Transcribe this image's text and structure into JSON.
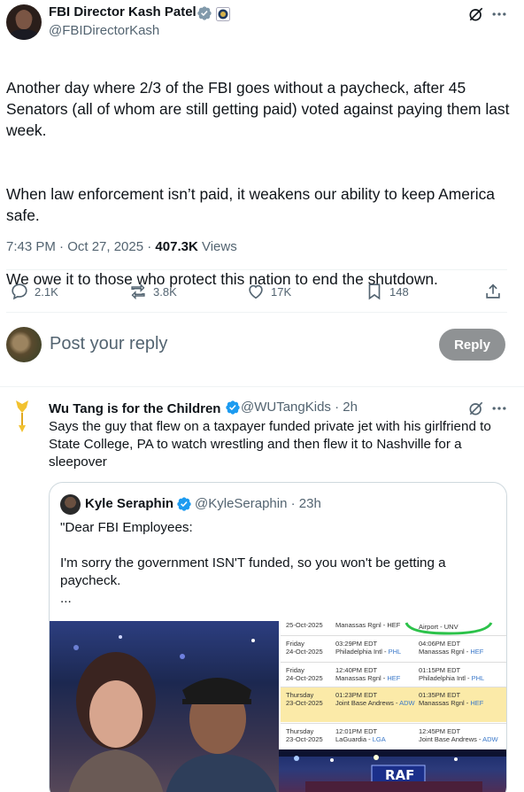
{
  "main_post": {
    "author_name": "FBI Director Kash Patel",
    "handle": "@FBIDirectorKash",
    "paragraphs": [
      "Another day where 2/3 of the FBI goes without a paycheck, after 45 Senators (all of whom are still getting paid) voted against paying them last week.",
      "When law enforcement isn’t paid, it weakens our ability to keep America safe.",
      "We owe it to those who protect this nation to end the shutdown."
    ],
    "timestamp": "7:43 PM · Oct 27, 2025 · ",
    "views_count": "407.3K",
    "views_label": " Views",
    "actions": {
      "replies": "2.1K",
      "reposts": "3.8K",
      "likes": "17K",
      "bookmarks": "148"
    }
  },
  "composer": {
    "placeholder": "Post your reply",
    "button": "Reply"
  },
  "reply": {
    "author_name": "Wu Tang is for the Children",
    "handle_time": "@WUTangKids · 2h",
    "text": "Says the guy that flew on a taxpayer funded private jet with his girlfriend to State College, PA to watch wrestling and then flew it to Nashville for a sleepover"
  },
  "quote": {
    "author_name": "Kyle Seraphin",
    "handle_time": "@KyleSeraphin · 23h",
    "text": "\"Dear FBI Employees:\n\nI'm sorry the government ISN'T funded, so you won't be getting a paycheck.\n..."
  },
  "flight_table": {
    "top_partial": {
      "left": "25-Oct-2025",
      "mid": "Manassas Rgnl - HEF",
      "right": "Airport - UNV"
    },
    "rows": [
      {
        "day": "Friday",
        "date": "24-Oct-2025",
        "dep_time": "03:29PM EDT",
        "dep_place": "Philadelphia Intl - ",
        "dep_code": "PHL",
        "arr_time": "04:06PM EDT",
        "arr_place": "Manassas Rgnl - ",
        "arr_code": "HEF",
        "highlight": false
      },
      {
        "day": "Friday",
        "date": "24-Oct-2025",
        "dep_time": "12:40PM EDT",
        "dep_place": "Manassas Rgnl - ",
        "dep_code": "HEF",
        "arr_time": "01:15PM EDT",
        "arr_place": "Philadelphia Intl - ",
        "arr_code": "PHL",
        "highlight": false
      },
      {
        "day": "Thursday",
        "date": "23-Oct-2025",
        "dep_time": "01:23PM EDT",
        "dep_place": "Joint Base Andrews - ",
        "dep_code": "ADW",
        "arr_time": "01:35PM EDT",
        "arr_place": "Manassas Rgnl - ",
        "arr_code": "HEF",
        "highlight": true
      },
      {
        "day": "Thursday",
        "date": "23-Oct-2025",
        "dep_time": "12:01PM EDT",
        "dep_place": "LaGuardia - ",
        "dep_code": "LGA",
        "arr_time": "12:45PM EDT",
        "arr_place": "Joint Base Andrews - ",
        "arr_code": "ADW",
        "highlight": false
      }
    ]
  },
  "arena_banner": "RAF",
  "colors": {
    "verified_blue": "#1d9bf0",
    "secondary_text": "#536471",
    "reply_button": "#8f9294",
    "highlight_row": "#fbeaa8",
    "link": "#3a78c9"
  },
  "icons": [
    "verified-icon",
    "gov-seal-icon",
    "grok-icon",
    "more-icon",
    "reply-icon",
    "repost-icon",
    "like-icon",
    "bookmark-icon",
    "share-icon"
  ]
}
